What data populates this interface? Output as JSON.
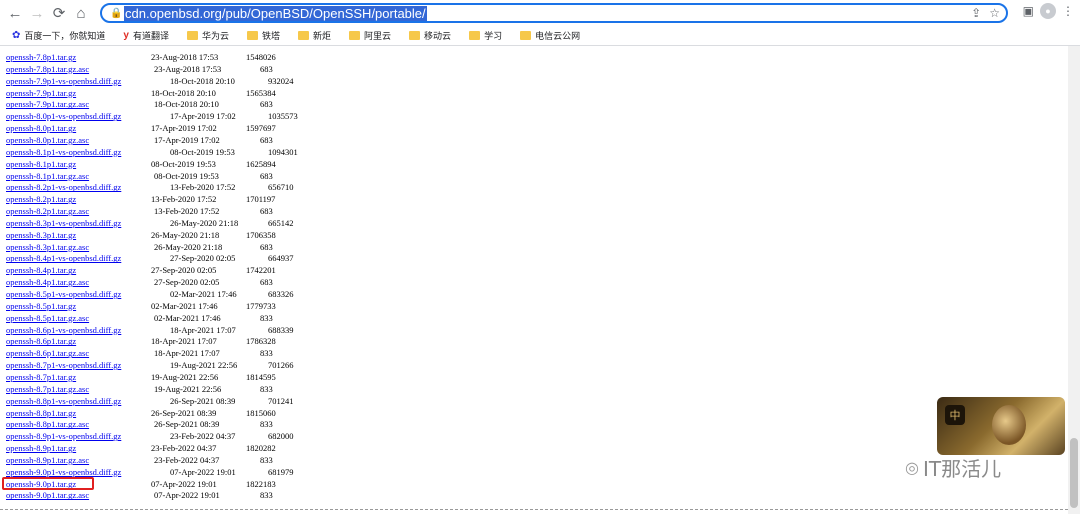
{
  "browser": {
    "url": "cdn.openbsd.org/pub/OpenBSD/OpenSSH/portable/",
    "back_icon": "arrow-left",
    "forward_icon": "arrow-right",
    "reload_icon": "reload",
    "home_icon": "home"
  },
  "bookmarks": [
    {
      "label": "百度一下，你就知道",
      "icon": "baidu-icon"
    },
    {
      "label": "有道翻译",
      "icon": "youdao-icon"
    },
    {
      "label": "华为云",
      "icon": "folder-icon"
    },
    {
      "label": "铁塔",
      "icon": "folder-icon"
    },
    {
      "label": "新炬",
      "icon": "folder-icon"
    },
    {
      "label": "阿里云",
      "icon": "folder-icon"
    },
    {
      "label": "移动云",
      "icon": "folder-icon"
    },
    {
      "label": "学习",
      "icon": "folder-icon"
    },
    {
      "label": "电信云公网",
      "icon": "folder-icon"
    }
  ],
  "files": [
    {
      "name": "openssh-7.8p1.tar.gz",
      "date": "23-Aug-2018 17:53",
      "size": "1548026"
    },
    {
      "name": "openssh-7.8p1.tar.gz.asc",
      "date": "23-Aug-2018 17:53",
      "size": "683"
    },
    {
      "name": "openssh-7.9p1-vs-openbsd.diff.gz",
      "date": "18-Oct-2018 20:10",
      "size": "932024"
    },
    {
      "name": "openssh-7.9p1.tar.gz",
      "date": "18-Oct-2018 20:10",
      "size": "1565384"
    },
    {
      "name": "openssh-7.9p1.tar.gz.asc",
      "date": "18-Oct-2018 20:10",
      "size": "683"
    },
    {
      "name": "openssh-8.0p1-vs-openbsd.diff.gz",
      "date": "17-Apr-2019 17:02",
      "size": "1035573"
    },
    {
      "name": "openssh-8.0p1.tar.gz",
      "date": "17-Apr-2019 17:02",
      "size": "1597697"
    },
    {
      "name": "openssh-8.0p1.tar.gz.asc",
      "date": "17-Apr-2019 17:02",
      "size": "683"
    },
    {
      "name": "openssh-8.1p1-vs-openbsd.diff.gz",
      "date": "08-Oct-2019 19:53",
      "size": "1094301"
    },
    {
      "name": "openssh-8.1p1.tar.gz",
      "date": "08-Oct-2019 19:53",
      "size": "1625894"
    },
    {
      "name": "openssh-8.1p1.tar.gz.asc",
      "date": "08-Oct-2019 19:53",
      "size": "683"
    },
    {
      "name": "openssh-8.2p1-vs-openbsd.diff.gz",
      "date": "13-Feb-2020 17:52",
      "size": "656710"
    },
    {
      "name": "openssh-8.2p1.tar.gz",
      "date": "13-Feb-2020 17:52",
      "size": "1701197"
    },
    {
      "name": "openssh-8.2p1.tar.gz.asc",
      "date": "13-Feb-2020 17:52",
      "size": "683"
    },
    {
      "name": "openssh-8.3p1-vs-openbsd.diff.gz",
      "date": "26-May-2020 21:18",
      "size": "665142"
    },
    {
      "name": "openssh-8.3p1.tar.gz",
      "date": "26-May-2020 21:18",
      "size": "1706358"
    },
    {
      "name": "openssh-8.3p1.tar.gz.asc",
      "date": "26-May-2020 21:18",
      "size": "683"
    },
    {
      "name": "openssh-8.4p1-vs-openbsd.diff.gz",
      "date": "27-Sep-2020 02:05",
      "size": "664937"
    },
    {
      "name": "openssh-8.4p1.tar.gz",
      "date": "27-Sep-2020 02:05",
      "size": "1742201"
    },
    {
      "name": "openssh-8.4p1.tar.gz.asc",
      "date": "27-Sep-2020 02:05",
      "size": "683"
    },
    {
      "name": "openssh-8.5p1-vs-openbsd.diff.gz",
      "date": "02-Mar-2021 17:46",
      "size": "683326"
    },
    {
      "name": "openssh-8.5p1.tar.gz",
      "date": "02-Mar-2021 17:46",
      "size": "1779733"
    },
    {
      "name": "openssh-8.5p1.tar.gz.asc",
      "date": "02-Mar-2021 17:46",
      "size": "833"
    },
    {
      "name": "openssh-8.6p1-vs-openbsd.diff.gz",
      "date": "18-Apr-2021 17:07",
      "size": "688339"
    },
    {
      "name": "openssh-8.6p1.tar.gz",
      "date": "18-Apr-2021 17:07",
      "size": "1786328"
    },
    {
      "name": "openssh-8.6p1.tar.gz.asc",
      "date": "18-Apr-2021 17:07",
      "size": "833"
    },
    {
      "name": "openssh-8.7p1-vs-openbsd.diff.gz",
      "date": "19-Aug-2021 22:56",
      "size": "701266"
    },
    {
      "name": "openssh-8.7p1.tar.gz",
      "date": "19-Aug-2021 22:56",
      "size": "1814595"
    },
    {
      "name": "openssh-8.7p1.tar.gz.asc",
      "date": "19-Aug-2021 22:56",
      "size": "833"
    },
    {
      "name": "openssh-8.8p1-vs-openbsd.diff.gz",
      "date": "26-Sep-2021 08:39",
      "size": "701241"
    },
    {
      "name": "openssh-8.8p1.tar.gz",
      "date": "26-Sep-2021 08:39",
      "size": "1815060"
    },
    {
      "name": "openssh-8.8p1.tar.gz.asc",
      "date": "26-Sep-2021 08:39",
      "size": "833"
    },
    {
      "name": "openssh-8.9p1-vs-openbsd.diff.gz",
      "date": "23-Feb-2022 04:37",
      "size": "682000"
    },
    {
      "name": "openssh-8.9p1.tar.gz",
      "date": "23-Feb-2022 04:37",
      "size": "1820282"
    },
    {
      "name": "openssh-8.9p1.tar.gz.asc",
      "date": "23-Feb-2022 04:37",
      "size": "833"
    },
    {
      "name": "openssh-9.0p1-vs-openbsd.diff.gz",
      "date": "07-Apr-2022 19:01",
      "size": "681979"
    },
    {
      "name": "openssh-9.0p1.tar.gz",
      "date": "07-Apr-2022 19:01",
      "size": "1822183"
    },
    {
      "name": "openssh-9.0p1.tar.gz.asc",
      "date": "07-Apr-2022 19:01",
      "size": "833"
    }
  ],
  "highlighted_file": "openssh-9.0p1.tar.gz",
  "watermark": {
    "text": "IT那活儿",
    "icon": "wechat-icon"
  },
  "colors": {
    "link": "#0000ee",
    "highlight": "#e02020",
    "omnibox_border": "#1a73e8"
  }
}
